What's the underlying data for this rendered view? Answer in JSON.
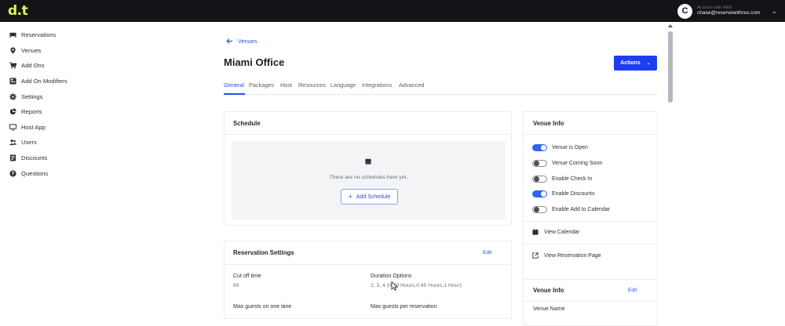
{
  "topbar": {
    "logo": "d.t",
    "user": {
      "avatar_initial": "C",
      "subtitle": "Account with REB",
      "email": "chase@reservewithrex.com"
    }
  },
  "sidebar": {
    "items": [
      {
        "label": "Reservations",
        "icon": "bed-icon"
      },
      {
        "label": "Venues",
        "icon": "map-pin-icon"
      },
      {
        "label": "Add Ons",
        "icon": "cart-icon"
      },
      {
        "label": "Add On Modifiers",
        "icon": "modifier-icon"
      },
      {
        "label": "Settings",
        "icon": "gear-icon"
      },
      {
        "label": "Reports",
        "icon": "pie-chart-icon"
      },
      {
        "label": "Host App",
        "icon": "monitor-icon"
      },
      {
        "label": "Users",
        "icon": "users-icon"
      },
      {
        "label": "Discounts",
        "icon": "discount-icon"
      },
      {
        "label": "Questions",
        "icon": "question-icon"
      }
    ]
  },
  "header": {
    "back_label": "Venues",
    "title": "Miami Office",
    "actions_label": "Actions"
  },
  "tabs": [
    {
      "label": "General",
      "active": true
    },
    {
      "label": "Packages",
      "active": false
    },
    {
      "label": "Host",
      "active": false
    },
    {
      "label": "Resources",
      "active": false
    },
    {
      "label": "Language",
      "active": false
    },
    {
      "label": "Integrations",
      "active": false
    },
    {
      "label": "Advanced",
      "active": false
    }
  ],
  "schedule": {
    "title": "Schedule",
    "empty_text": "There are no schedules here yet.",
    "add_label": "Add Schedule"
  },
  "reservation_settings": {
    "title": "Reservation Settings",
    "edit_label": "Edit",
    "fields": [
      {
        "label": "Cut off time",
        "value": "60"
      },
      {
        "label": "Duration Options",
        "value": "2, 3, 4 (0:30 Hours,0:45 Hours,1 Hour)"
      },
      {
        "label": "Max guests on one lane",
        "value": ""
      },
      {
        "label": "Max guests per reservation",
        "value": ""
      }
    ]
  },
  "venue_info": {
    "title": "Venue Info",
    "toggles": [
      {
        "label": "Venue is Open",
        "on": true
      },
      {
        "label": "Venue Coming Soon",
        "on": false
      },
      {
        "label": "Enable Check In",
        "on": false
      },
      {
        "label": "Enable Discounts",
        "on": true
      },
      {
        "label": "Enable Add to Calendar",
        "on": false
      }
    ],
    "links": [
      {
        "label": "View Calendar",
        "icon": "calendar-icon"
      },
      {
        "label": "View Reservation Page",
        "icon": "external-link-icon"
      }
    ]
  },
  "venue_info_2": {
    "title": "Venue Info",
    "edit_label": "Edit",
    "field_label": "Venue Name"
  },
  "colors": {
    "accent": "#2b4de0",
    "button": "#1f3df0",
    "topbar": "#121418",
    "logo": "#e2f35a",
    "toggle_on": "#2f66f0"
  }
}
